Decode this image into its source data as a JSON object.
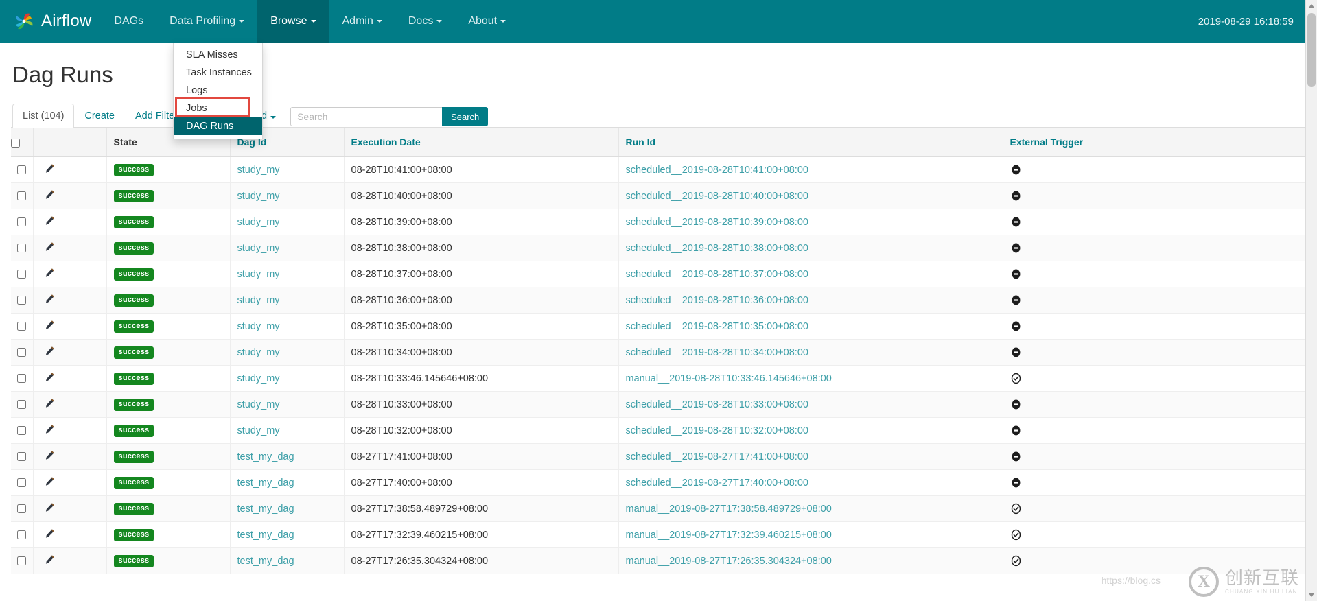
{
  "navbar": {
    "brand": "Airflow",
    "brand_logo_icon": "airflow-pinwheel-logo",
    "items": [
      {
        "label": "DAGs",
        "has_caret": false
      },
      {
        "label": "Data Profiling",
        "has_caret": true
      },
      {
        "label": "Browse",
        "has_caret": true
      },
      {
        "label": "Admin",
        "has_caret": true
      },
      {
        "label": "Docs",
        "has_caret": true
      },
      {
        "label": "About",
        "has_caret": true
      }
    ],
    "clock": "2019-08-29 16:18:59",
    "background_color": "#017c87"
  },
  "dropdown": {
    "owner": "Browse",
    "items": [
      {
        "label": "SLA Misses",
        "active": false
      },
      {
        "label": "Task Instances",
        "active": false
      },
      {
        "label": "Logs",
        "active": false
      },
      {
        "label": "Jobs",
        "active": false
      },
      {
        "label": "DAG Runs",
        "active": true
      }
    ],
    "annotation_color": "#e2483f"
  },
  "page": {
    "title": "Dag Runs"
  },
  "tabs": [
    {
      "label": "List (104)",
      "active": true,
      "caret": false
    },
    {
      "label": "Create",
      "active": false,
      "caret": false
    },
    {
      "label": "Add Filter",
      "active": false,
      "caret": true
    },
    {
      "label": "With selected",
      "active": false,
      "caret": true
    }
  ],
  "search": {
    "value": "",
    "placeholder": "Search",
    "button_label": "Search"
  },
  "table": {
    "columns": [
      {
        "key": "checkbox",
        "label": "",
        "link": false
      },
      {
        "key": "edit",
        "label": "",
        "link": false
      },
      {
        "key": "state",
        "label": "State",
        "link": false
      },
      {
        "key": "dag_id",
        "label": "Dag Id",
        "link": true
      },
      {
        "key": "execution_date",
        "label": "Execution Date",
        "link": true
      },
      {
        "key": "run_id",
        "label": "Run Id",
        "link": true
      },
      {
        "key": "external_trigger",
        "label": "External Trigger",
        "link": true
      }
    ],
    "rows": [
      {
        "state": "success",
        "dag_id": "study_my",
        "execution_date": "08-28T10:41:00+08:00",
        "run_id": "scheduled__2019-08-28T10:41:00+08:00",
        "external_trigger": "false"
      },
      {
        "state": "success",
        "dag_id": "study_my",
        "execution_date": "08-28T10:40:00+08:00",
        "run_id": "scheduled__2019-08-28T10:40:00+08:00",
        "external_trigger": "false"
      },
      {
        "state": "success",
        "dag_id": "study_my",
        "execution_date": "08-28T10:39:00+08:00",
        "run_id": "scheduled__2019-08-28T10:39:00+08:00",
        "external_trigger": "false"
      },
      {
        "state": "success",
        "dag_id": "study_my",
        "execution_date": "08-28T10:38:00+08:00",
        "run_id": "scheduled__2019-08-28T10:38:00+08:00",
        "external_trigger": "false"
      },
      {
        "state": "success",
        "dag_id": "study_my",
        "execution_date": "08-28T10:37:00+08:00",
        "run_id": "scheduled__2019-08-28T10:37:00+08:00",
        "external_trigger": "false"
      },
      {
        "state": "success",
        "dag_id": "study_my",
        "execution_date": "08-28T10:36:00+08:00",
        "run_id": "scheduled__2019-08-28T10:36:00+08:00",
        "external_trigger": "false"
      },
      {
        "state": "success",
        "dag_id": "study_my",
        "execution_date": "08-28T10:35:00+08:00",
        "run_id": "scheduled__2019-08-28T10:35:00+08:00",
        "external_trigger": "false"
      },
      {
        "state": "success",
        "dag_id": "study_my",
        "execution_date": "08-28T10:34:00+08:00",
        "run_id": "scheduled__2019-08-28T10:34:00+08:00",
        "external_trigger": "false"
      },
      {
        "state": "success",
        "dag_id": "study_my",
        "execution_date": "08-28T10:33:46.145646+08:00",
        "run_id": "manual__2019-08-28T10:33:46.145646+08:00",
        "external_trigger": "true"
      },
      {
        "state": "success",
        "dag_id": "study_my",
        "execution_date": "08-28T10:33:00+08:00",
        "run_id": "scheduled__2019-08-28T10:33:00+08:00",
        "external_trigger": "false"
      },
      {
        "state": "success",
        "dag_id": "study_my",
        "execution_date": "08-28T10:32:00+08:00",
        "run_id": "scheduled__2019-08-28T10:32:00+08:00",
        "external_trigger": "false"
      },
      {
        "state": "success",
        "dag_id": "test_my_dag",
        "execution_date": "08-27T17:41:00+08:00",
        "run_id": "scheduled__2019-08-27T17:41:00+08:00",
        "external_trigger": "false"
      },
      {
        "state": "success",
        "dag_id": "test_my_dag",
        "execution_date": "08-27T17:40:00+08:00",
        "run_id": "scheduled__2019-08-27T17:40:00+08:00",
        "external_trigger": "false"
      },
      {
        "state": "success",
        "dag_id": "test_my_dag",
        "execution_date": "08-27T17:38:58.489729+08:00",
        "run_id": "manual__2019-08-27T17:38:58.489729+08:00",
        "external_trigger": "true"
      },
      {
        "state": "success",
        "dag_id": "test_my_dag",
        "execution_date": "08-27T17:32:39.460215+08:00",
        "run_id": "manual__2019-08-27T17:32:39.460215+08:00",
        "external_trigger": "true"
      },
      {
        "state": "success",
        "dag_id": "test_my_dag",
        "execution_date": "08-27T17:26:35.304324+08:00",
        "run_id": "manual__2019-08-27T17:26:35.304324+08:00",
        "external_trigger": "true"
      }
    ]
  },
  "watermark": {
    "url": "https://blog.cs",
    "mark_letter": "X",
    "cn_text": "创新互联",
    "pinyin_text": "CHUANG XIN HU LIAN"
  },
  "colors": {
    "brand_teal": "#017c87",
    "dark_teal": "#00646d",
    "link_teal": "#3d9fa8",
    "success_green": "#14871f",
    "annotation_red": "#e2483f"
  }
}
